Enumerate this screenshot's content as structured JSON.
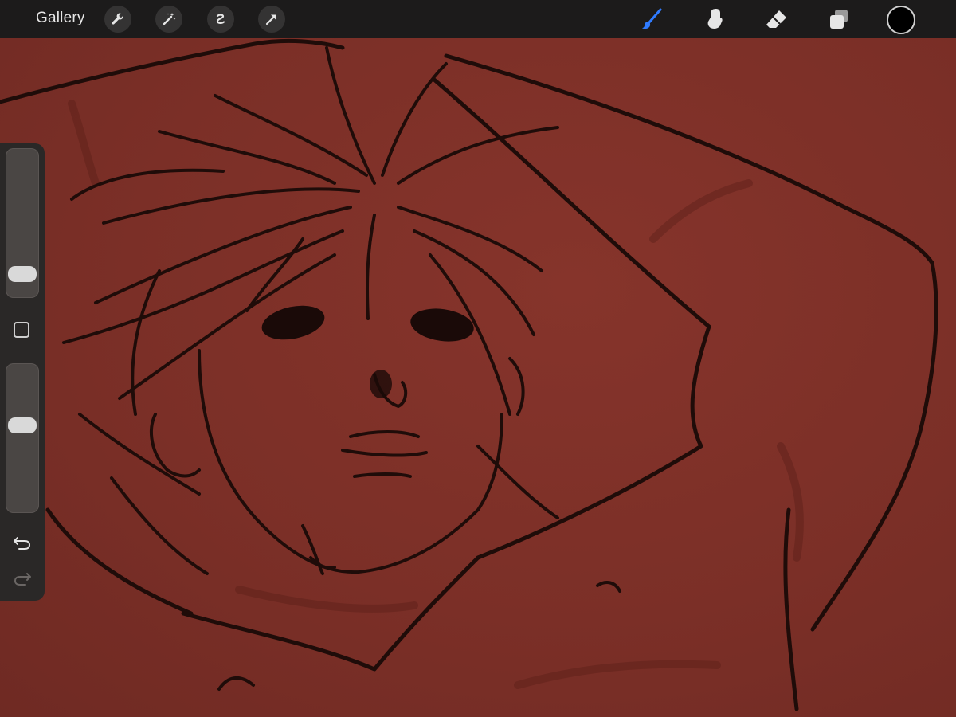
{
  "toolbar": {
    "gallery_label": "Gallery",
    "left_tools": [
      {
        "name": "actions-wrench-icon"
      },
      {
        "name": "adjustments-magic-wand-icon"
      },
      {
        "name": "selection-s-curve-icon"
      },
      {
        "name": "transform-arrow-icon"
      }
    ],
    "right_tools": [
      {
        "name": "brush-icon",
        "active": true
      },
      {
        "name": "smudge-icon"
      },
      {
        "name": "eraser-icon"
      },
      {
        "name": "layers-icon"
      }
    ],
    "current_color": "#000000",
    "active_color": "#2f7bff"
  },
  "sidebar": {
    "brush_size_level": 0.1,
    "opacity_level": 0.6
  },
  "canvas": {
    "background_color": "#7b2f27",
    "stroke_color": "#1a0a08"
  }
}
